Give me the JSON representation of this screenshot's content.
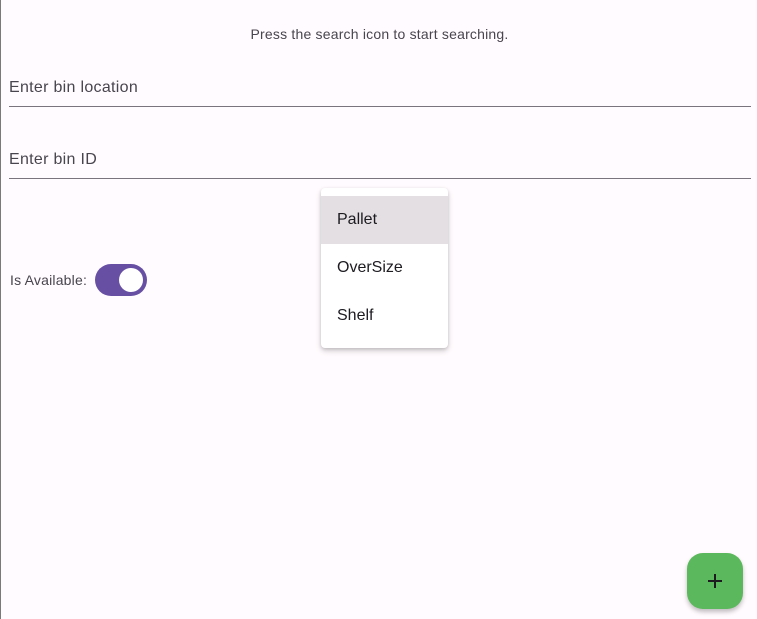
{
  "search": {
    "hint": "Press the search icon to start searching."
  },
  "form": {
    "bin_location": {
      "placeholder": "Enter bin location",
      "value": ""
    },
    "bin_id": {
      "placeholder": "Enter bin ID",
      "value": ""
    },
    "availability": {
      "label": "Is Available:",
      "checked": true
    }
  },
  "bin_type_menu": {
    "items": [
      {
        "label": "Pallet",
        "selected": true
      },
      {
        "label": "OverSize",
        "selected": false
      },
      {
        "label": "Shelf",
        "selected": false
      }
    ]
  },
  "fab": {
    "icon": "add-icon"
  },
  "colors": {
    "switch_track": "#6750a4",
    "fab_background": "#5cb85c",
    "menu_selected": "#e3dfe3",
    "page_background": "#fffbfe"
  }
}
